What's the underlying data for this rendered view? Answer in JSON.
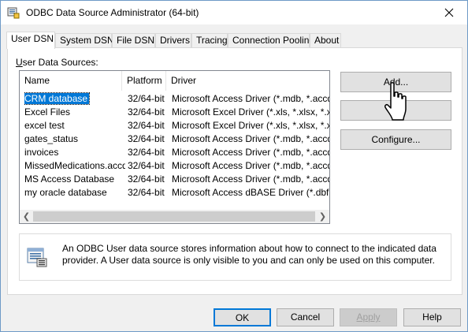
{
  "window": {
    "title": "ODBC Data Source Administrator (64-bit)"
  },
  "tabs": [
    {
      "label": "User DSN"
    },
    {
      "label": "System DSN"
    },
    {
      "label": "File DSN"
    },
    {
      "label": "Drivers"
    },
    {
      "label": "Tracing"
    },
    {
      "label": "Connection Pooling"
    },
    {
      "label": "About"
    }
  ],
  "sources": {
    "label": "User Data Sources:",
    "columns": [
      "Name",
      "Platform",
      "Driver"
    ],
    "rows": [
      {
        "name": "CRM database",
        "platform": "32/64-bit",
        "driver": "Microsoft Access Driver (*.mdb, *.accdb)"
      },
      {
        "name": "Excel Files",
        "platform": "32/64-bit",
        "driver": "Microsoft Excel Driver (*.xls, *.xlsx, *.xlsm, *"
      },
      {
        "name": "excel test",
        "platform": "32/64-bit",
        "driver": "Microsoft Excel Driver (*.xls, *.xlsx, *.xlsm, *"
      },
      {
        "name": "gates_status",
        "platform": "32/64-bit",
        "driver": "Microsoft Access Driver (*.mdb, *.accdb)"
      },
      {
        "name": "invoices",
        "platform": "32/64-bit",
        "driver": "Microsoft Access Driver (*.mdb, *.accdb)"
      },
      {
        "name": "MissedMedications.accdb",
        "platform": "32/64-bit",
        "driver": "Microsoft Access Driver (*.mdb, *.accdb)"
      },
      {
        "name": "MS Access Database",
        "platform": "32/64-bit",
        "driver": "Microsoft Access Driver (*.mdb, *.accdb)"
      },
      {
        "name": "my oracle database",
        "platform": "32/64-bit",
        "driver": "Microsoft Access dBASE Driver (*.dbf, *.nd"
      }
    ]
  },
  "buttons": {
    "add": "Add...",
    "remove": "Re",
    "configure": "Configure...",
    "ok": "OK",
    "cancel": "Cancel",
    "apply": "Apply",
    "help": "Help"
  },
  "info": {
    "text": "An ODBC User data source stores information about how to connect to the indicated data provider.   A User data source is only visible to you and can only be used on this computer."
  }
}
